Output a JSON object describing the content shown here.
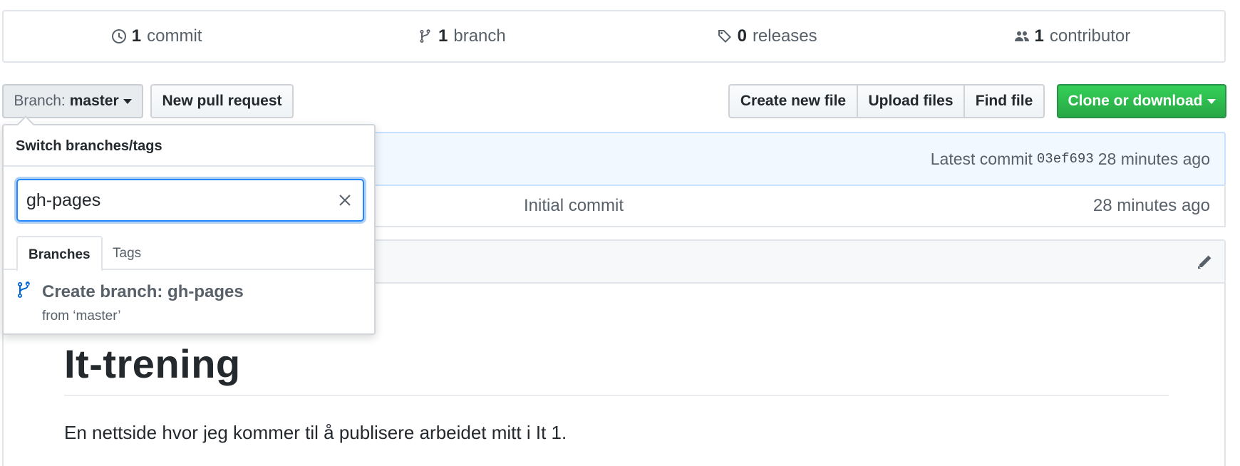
{
  "summary": {
    "commits": {
      "count": "1",
      "label": "commit"
    },
    "branches": {
      "count": "1",
      "label": "branch"
    },
    "releases": {
      "count": "0",
      "label": "releases"
    },
    "contributors": {
      "count": "1",
      "label": "contributor"
    }
  },
  "toolbar": {
    "branch_prefix": "Branch:",
    "branch_name": "master",
    "new_pr": "New pull request",
    "create_file": "Create new file",
    "upload_files": "Upload files",
    "find_file": "Find file",
    "clone": "Clone or download"
  },
  "commit_tease": {
    "label": "Latest commit",
    "sha": "03ef693",
    "age": "28 minutes ago"
  },
  "file_row": {
    "message": "Initial commit",
    "age": "28 minutes ago"
  },
  "readme": {
    "title": "It-trening",
    "text": "En nettside hvor jeg kommer til å publisere arbeidet mitt i It 1."
  },
  "dropdown": {
    "title": "Switch branches/tags",
    "filter_value": "gh-pages",
    "tabs": [
      "Branches",
      "Tags"
    ],
    "create_label": "Create branch: gh-pages",
    "create_from": "from ‘master’"
  },
  "colors": {
    "accent_blue": "#0366d6",
    "clone_green": "#28a745",
    "tease_bg": "#f1f8ff"
  }
}
